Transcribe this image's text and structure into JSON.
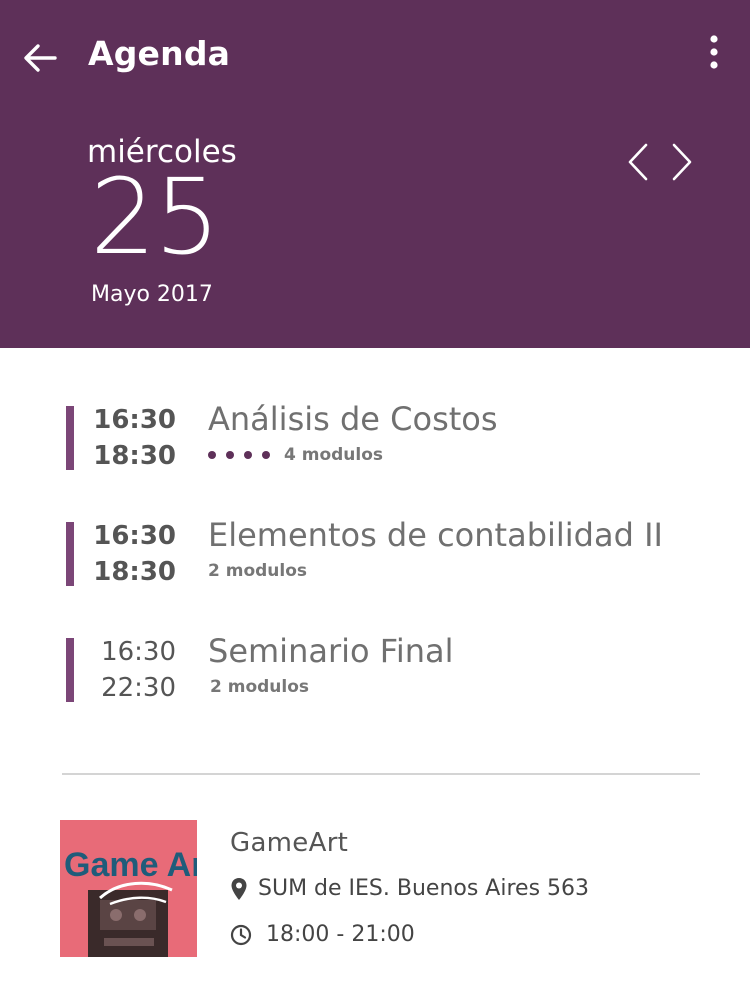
{
  "app_bar": {
    "title": "Agenda"
  },
  "date": {
    "weekday": "miércoles",
    "day": "25",
    "month_year": "Mayo 2017"
  },
  "events": [
    {
      "start": "16:30",
      "end": "18:30",
      "title": "Análisis de Costos",
      "modules": "4 modulos",
      "dots": 4,
      "bold_time": true
    },
    {
      "start": "16:30",
      "end": "18:30",
      "title": "Elementos de contabilidad II",
      "modules": "2 modulos",
      "dots": 0,
      "bold_time": true
    },
    {
      "start": "16:30",
      "end": "22:30",
      "title": "Seminario Final",
      "modules": "2 modulos",
      "dots": 0,
      "bold_time": false
    }
  ],
  "featured": {
    "title": "GameArt",
    "location": "SUM de IES. Buenos Aires 563",
    "time": "18:00 - 21:00",
    "thumbnail_logo": "Game Arts"
  },
  "icons": {
    "back": "arrow-left-icon",
    "more": "more-vertical-icon",
    "prev": "chevron-left-icon",
    "next": "chevron-right-icon",
    "location": "map-pin-icon",
    "time": "clock-icon"
  },
  "colors": {
    "header_bg": "#5e3059",
    "accent_bar": "#7b4677",
    "thumbnail_bg": "#e86b78"
  }
}
